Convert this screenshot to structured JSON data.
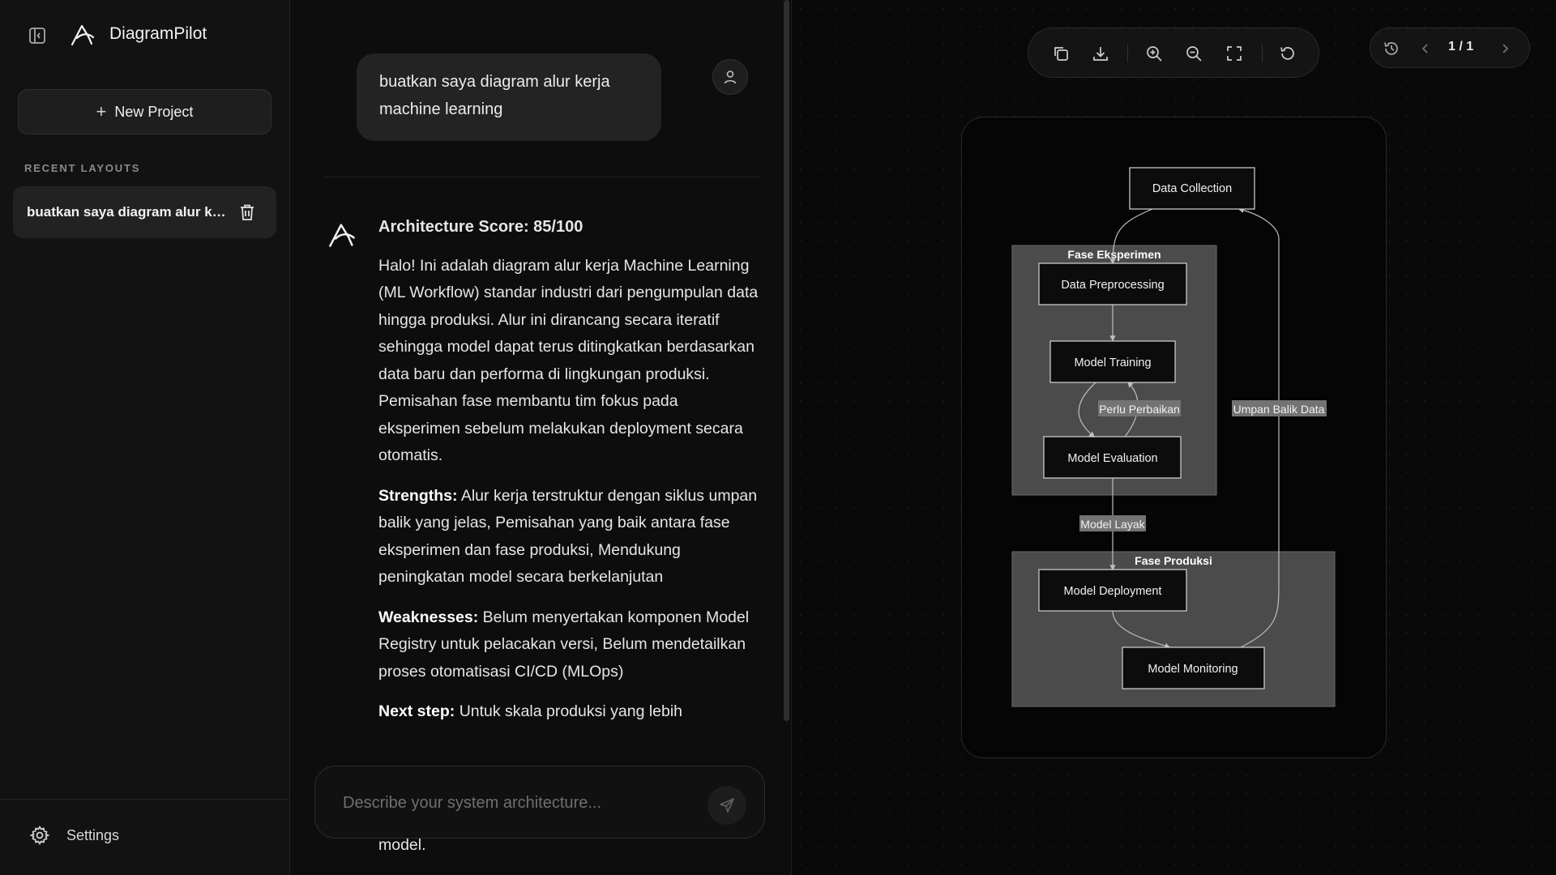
{
  "app": {
    "title": "DiagramPilot"
  },
  "sidebar": {
    "new_project_label": "New Project",
    "recent_heading": "RECENT LAYOUTS",
    "recent_items": [
      {
        "label": "buatkan saya diagram alur kerja machine learning"
      }
    ],
    "settings_label": "Settings"
  },
  "chat": {
    "user_message": "buatkan saya diagram alur kerja machine learning",
    "assistant": {
      "score": "Architecture Score: 85/100",
      "intro": "Halo! Ini adalah diagram alur kerja Machine Learning (ML Workflow) standar industri dari pengumpulan data hingga produksi. Alur ini dirancang secara iteratif sehingga model dapat terus ditingkatkan berdasarkan data baru dan performa di lingkungan produksi. Pemisahan fase membantu tim fokus pada eksperimen sebelum melakukan deployment secara otomatis.",
      "strengths_label": "Strengths:",
      "strengths": "Alur kerja terstruktur dengan siklus umpan balik yang jelas, Pemisahan yang baik antara fase eksperimen dan fase produksi, Mendukung peningkatan model secara berkelanjutan",
      "weaknesses_label": "Weaknesses:",
      "weaknesses": "Belum menyertakan komponen Model Registry untuk pelacakan versi, Belum mendetailkan proses otomatisasi CI/CD (MLOps)",
      "next_label": "Next step:",
      "next": "Untuk skala produksi yang lebih",
      "tail": "model."
    },
    "composer": {
      "placeholder": "Describe your system architecture..."
    }
  },
  "canvas": {
    "pager_text": "1 / 1",
    "diagram": {
      "clusters": {
        "experiment": "Fase Eksperimen",
        "production": "Fase Produksi"
      },
      "nodes": {
        "data_collection": "Data Collection",
        "data_preprocessing": "Data Preprocessing",
        "model_training": "Model Training",
        "model_evaluation": "Model Evaluation",
        "model_deployment": "Model Deployment",
        "model_monitoring": "Model Monitoring"
      },
      "edge_labels": {
        "perlu_perbaikan": "Perlu Perbaikan",
        "model_layak": "Model Layak",
        "umpan_balik": "Umpan Balik Data"
      }
    }
  },
  "colors": {
    "background": "#0b0b0b",
    "sidebar": "#121212",
    "cluster": "#4b4b4b"
  }
}
